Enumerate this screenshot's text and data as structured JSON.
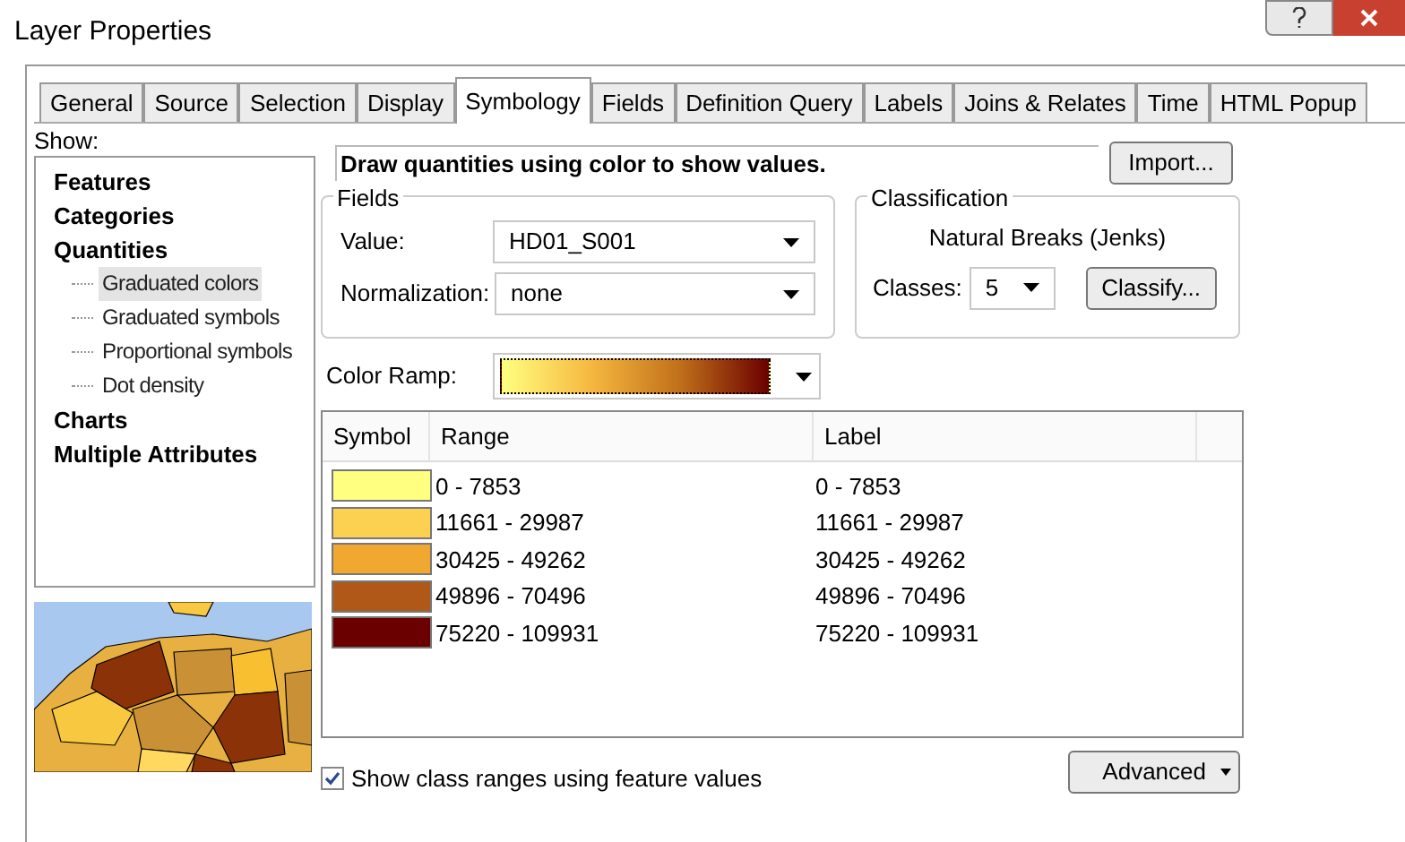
{
  "window": {
    "title": "Layer Properties"
  },
  "tabs": [
    {
      "label": "General",
      "selected": false
    },
    {
      "label": "Source",
      "selected": false
    },
    {
      "label": "Selection",
      "selected": false
    },
    {
      "label": "Display",
      "selected": false
    },
    {
      "label": "Symbology",
      "selected": true
    },
    {
      "label": "Fields",
      "selected": false
    },
    {
      "label": "Definition Query",
      "selected": false
    },
    {
      "label": "Labels",
      "selected": false
    },
    {
      "label": "Joins & Relates",
      "selected": false
    },
    {
      "label": "Time",
      "selected": false
    },
    {
      "label": "HTML Popup",
      "selected": false
    }
  ],
  "show_label": "Show:",
  "show_tree": [
    {
      "label": "Features",
      "selected": false
    },
    {
      "label": "Categories",
      "selected": false
    },
    {
      "label": "Quantities",
      "selected": false,
      "children": [
        {
          "label": "Graduated colors",
          "selected": true
        },
        {
          "label": "Graduated symbols",
          "selected": false
        },
        {
          "label": "Proportional symbols",
          "selected": false
        },
        {
          "label": "Dot density",
          "selected": false
        }
      ]
    },
    {
      "label": "Charts",
      "selected": false
    },
    {
      "label": "Multiple Attributes",
      "selected": false
    }
  ],
  "description": "Draw quantities using color to show values.",
  "import_button": "Import...",
  "fields": {
    "title": "Fields",
    "value": {
      "label": "Value:",
      "value": "HD01_S001"
    },
    "normalization": {
      "label": "Normalization:",
      "value": "none"
    }
  },
  "classification": {
    "title": "Classification",
    "method": "Natural Breaks (Jenks)",
    "classes": {
      "label": "Classes:",
      "value": "5"
    },
    "classify_button": "Classify..."
  },
  "color_ramp": {
    "label": "Color Ramp:"
  },
  "table": {
    "columns": [
      "Symbol",
      "Range",
      "Label"
    ],
    "rows": [
      {
        "color": "#ffff80",
        "range": "0 - 7853",
        "label": "0 - 7853"
      },
      {
        "color": "#fcd050",
        "range": "11661 - 29987",
        "label": "11661 - 29987"
      },
      {
        "color": "#f0a830",
        "range": "30425 - 49262",
        "label": "30425 - 49262"
      },
      {
        "color": "#b05818",
        "range": "49896 - 70496",
        "label": "49896 - 70496"
      },
      {
        "color": "#6b0000",
        "range": "75220 - 109931",
        "label": "75220 - 109931"
      }
    ]
  },
  "show_class_ranges": {
    "label": "Show class ranges using feature values",
    "checked": true
  },
  "advanced_button": "Advanced"
}
